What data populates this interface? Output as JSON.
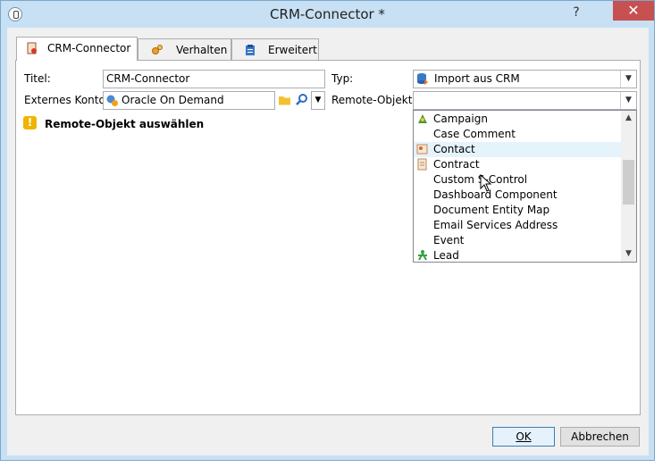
{
  "window": {
    "title": "CRM-Connector *",
    "help_label": "?",
    "close_label": "✕"
  },
  "tabs": [
    {
      "label": "CRM-Connector",
      "icon": "crm-connector-icon"
    },
    {
      "label": "Verhalten",
      "icon": "gears-icon"
    },
    {
      "label": "Erweitert",
      "icon": "clipboard-icon"
    }
  ],
  "form": {
    "titel_label": "Titel:",
    "titel_value": "CRM-Connector",
    "typ_label": "Typ:",
    "typ_value": "Import aus CRM",
    "konto_label": "Externes Konto:",
    "konto_value": "Oracle On Demand",
    "remote_label": "Remote-Objekt:",
    "remote_value": ""
  },
  "warning": {
    "text": "Remote-Objekt auswählen"
  },
  "dropdown": {
    "items": [
      {
        "label": "Campaign",
        "icon": "campaign-icon"
      },
      {
        "label": "Case Comment",
        "icon": ""
      },
      {
        "label": "Contact",
        "icon": "contact-icon"
      },
      {
        "label": "Contract",
        "icon": "contract-icon"
      },
      {
        "label": "Custom S-Control",
        "icon": ""
      },
      {
        "label": "Dashboard Component",
        "icon": ""
      },
      {
        "label": "Document Entity Map",
        "icon": ""
      },
      {
        "label": "Email Services Address",
        "icon": ""
      },
      {
        "label": "Event",
        "icon": ""
      },
      {
        "label": "Lead",
        "icon": "lead-icon"
      }
    ],
    "hover_index": 2
  },
  "buttons": {
    "ok_label": "OK",
    "cancel_label": "Abbrechen"
  },
  "colors": {
    "accent": "#3c7fb1",
    "warning": "#f0b400",
    "close": "#c75050"
  }
}
